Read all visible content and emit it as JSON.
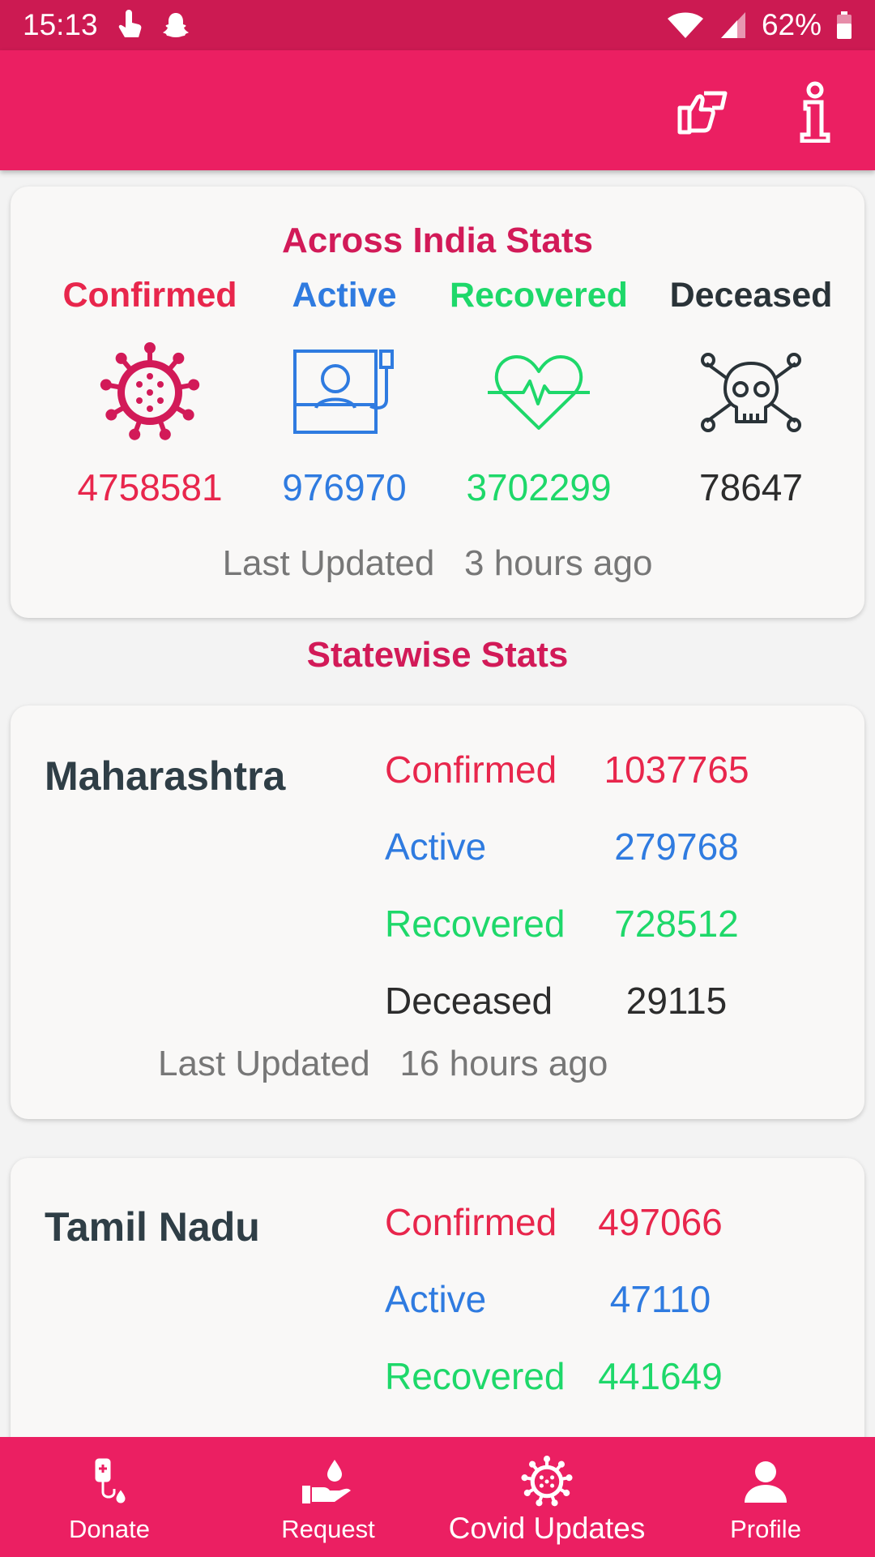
{
  "status_bar": {
    "time": "15:13",
    "battery": "62%"
  },
  "app_bar": {
    "actions": [
      {
        "name": "feedback-icon"
      },
      {
        "name": "info-icon"
      }
    ]
  },
  "india_stats": {
    "title": "Across India Stats",
    "columns": [
      {
        "label": "Confirmed",
        "icon": "virus-icon",
        "value": "4758581",
        "color": "#e8264c"
      },
      {
        "label": "Active",
        "icon": "patient-bed-icon",
        "value": "976970",
        "color": "#2f7be0"
      },
      {
        "label": "Recovered",
        "icon": "heartbeat-icon",
        "value": "3702299",
        "color": "#1ed86a"
      },
      {
        "label": "Deceased",
        "icon": "skull-crossbones-icon",
        "value": "78647",
        "color": "#2a3338"
      }
    ],
    "updated_label": "Last Updated",
    "updated_value": "3 hours ago"
  },
  "statewise": {
    "title": "Statewise Stats",
    "states": [
      {
        "name": "Maharashtra",
        "rows": [
          {
            "label": "Confirmed",
            "value": "1037765"
          },
          {
            "label": "Active",
            "value": "279768"
          },
          {
            "label": "Recovered",
            "value": "728512"
          },
          {
            "label": "Deceased",
            "value": "29115"
          }
        ],
        "updated_label": "Last Updated",
        "updated_value": "16 hours ago"
      },
      {
        "name": "Tamil Nadu",
        "rows": [
          {
            "label": "Confirmed",
            "value": "497066"
          },
          {
            "label": "Active",
            "value": "47110"
          },
          {
            "label": "Recovered",
            "value": "441649"
          }
        ]
      }
    ]
  },
  "bottom_nav": {
    "items": [
      {
        "label": "Donate",
        "icon": "blood-bag-icon"
      },
      {
        "label": "Request",
        "icon": "hand-drop-icon"
      },
      {
        "label": "Covid Updates",
        "icon": "virus-icon",
        "active": true
      },
      {
        "label": "Profile",
        "icon": "person-icon"
      }
    ]
  },
  "colors": {
    "primary": "#eb1f62",
    "status_bar": "#cc1a52",
    "heading": "#d21a58"
  }
}
